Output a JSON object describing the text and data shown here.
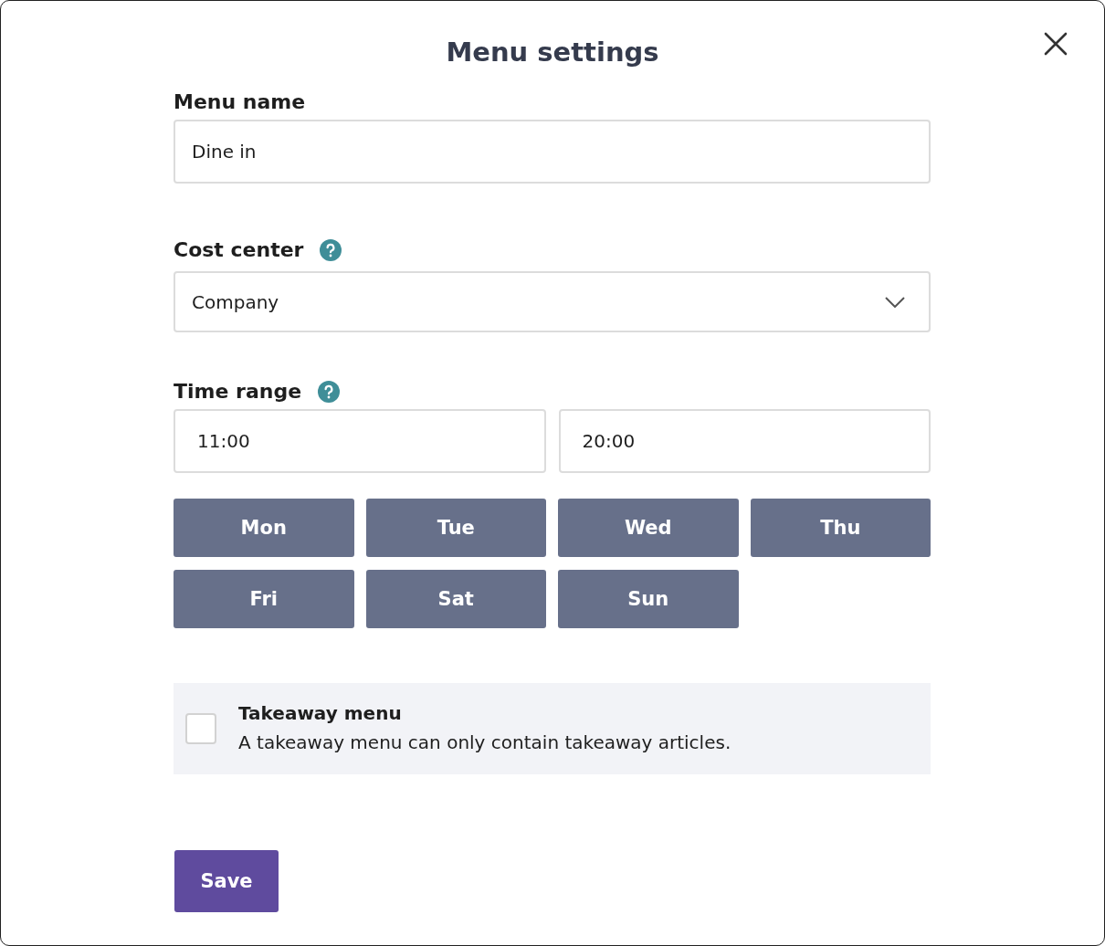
{
  "dialog": {
    "title": "Menu settings"
  },
  "menu_name": {
    "label": "Menu name",
    "value": "Dine in"
  },
  "cost_center": {
    "label": "Cost center",
    "value": "Company"
  },
  "time_range": {
    "label": "Time range",
    "start": "11:00",
    "end": "20:00"
  },
  "days": [
    {
      "label": "Mon",
      "selected": true
    },
    {
      "label": "Tue",
      "selected": true
    },
    {
      "label": "Wed",
      "selected": true
    },
    {
      "label": "Thu",
      "selected": true
    },
    {
      "label": "Fri",
      "selected": true
    },
    {
      "label": "Sat",
      "selected": true
    },
    {
      "label": "Sun",
      "selected": true
    }
  ],
  "takeaway": {
    "title": "Takeaway menu",
    "description": "A takeaway menu can only contain takeaway articles.",
    "checked": false
  },
  "buttons": {
    "save": "Save"
  }
}
